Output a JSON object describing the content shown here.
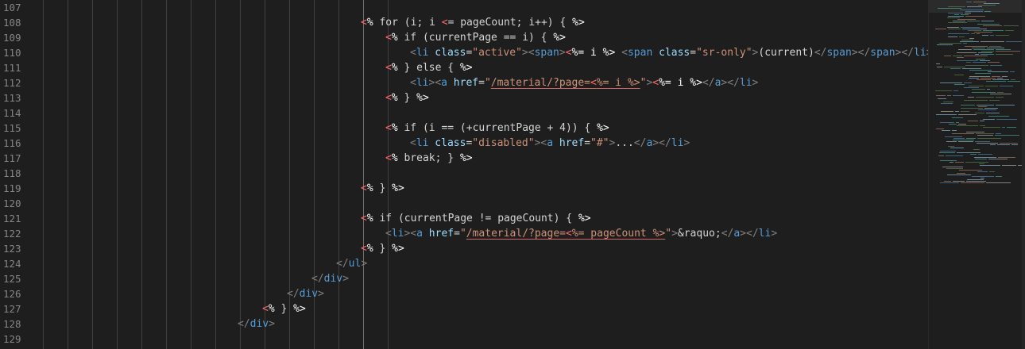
{
  "editor": {
    "lines": [
      {
        "num": "107",
        "indent": 0,
        "parts": []
      },
      {
        "num": "108",
        "indent": 454,
        "parts": [
          {
            "t": "<",
            "c": "tk-open"
          },
          {
            "t": "%",
            "c": "tk-delim"
          },
          {
            "t": " for (i; i ",
            "c": "tk-ejs"
          },
          {
            "t": "<",
            "c": "tk-open"
          },
          {
            "t": "= pageCount; i++) { ",
            "c": "tk-ejs"
          },
          {
            "t": "%>",
            "c": "tk-delim"
          }
        ]
      },
      {
        "num": "109",
        "indent": 485,
        "parts": [
          {
            "t": "<",
            "c": "tk-open"
          },
          {
            "t": "%",
            "c": "tk-delim"
          },
          {
            "t": " if (currentPage == i) { ",
            "c": "tk-ejs"
          },
          {
            "t": "%>",
            "c": "tk-delim"
          }
        ]
      },
      {
        "num": "110",
        "indent": 516,
        "parts": [
          {
            "t": "<",
            "c": "tk-punc"
          },
          {
            "t": "li",
            "c": "tk-tag"
          },
          {
            "t": " class",
            "c": "tk-attr"
          },
          {
            "t": "=",
            "c": "tk-ejs"
          },
          {
            "t": "\"active\"",
            "c": "tk-str"
          },
          {
            "t": ">",
            "c": "tk-punc"
          },
          {
            "t": "<",
            "c": "tk-punc"
          },
          {
            "t": "span",
            "c": "tk-tag"
          },
          {
            "t": ">",
            "c": "tk-punc"
          },
          {
            "t": "<",
            "c": "tk-open"
          },
          {
            "t": "%= i %>",
            "c": "tk-delim"
          },
          {
            "t": " ",
            "c": "tk-ejs"
          },
          {
            "t": "<",
            "c": "tk-punc"
          },
          {
            "t": "span",
            "c": "tk-tag"
          },
          {
            "t": " class",
            "c": "tk-attr"
          },
          {
            "t": "=",
            "c": "tk-ejs"
          },
          {
            "t": "\"sr-only\"",
            "c": "tk-str"
          },
          {
            "t": ">",
            "c": "tk-punc"
          },
          {
            "t": "(current)",
            "c": "tk-ejs"
          },
          {
            "t": "</",
            "c": "tk-punc"
          },
          {
            "t": "span",
            "c": "tk-tag"
          },
          {
            "t": ">",
            "c": "tk-punc"
          },
          {
            "t": "</",
            "c": "tk-punc"
          },
          {
            "t": "span",
            "c": "tk-tag"
          },
          {
            "t": ">",
            "c": "tk-punc"
          },
          {
            "t": "</",
            "c": "tk-punc"
          },
          {
            "t": "li",
            "c": "tk-tag"
          },
          {
            "t": ">",
            "c": "tk-punc"
          }
        ]
      },
      {
        "num": "111",
        "indent": 485,
        "parts": [
          {
            "t": "<",
            "c": "tk-open"
          },
          {
            "t": "%",
            "c": "tk-delim"
          },
          {
            "t": " } else { ",
            "c": "tk-ejs"
          },
          {
            "t": "%>",
            "c": "tk-delim"
          }
        ]
      },
      {
        "num": "112",
        "indent": 516,
        "parts": [
          {
            "t": "<",
            "c": "tk-punc"
          },
          {
            "t": "li",
            "c": "tk-tag"
          },
          {
            "t": ">",
            "c": "tk-punc"
          },
          {
            "t": "<",
            "c": "tk-punc"
          },
          {
            "t": "a",
            "c": "tk-tag"
          },
          {
            "t": " href",
            "c": "tk-attr"
          },
          {
            "t": "=",
            "c": "tk-ejs"
          },
          {
            "t": "\"",
            "c": "tk-str"
          },
          {
            "t": "/material/?page=",
            "c": "tk-str ul-str"
          },
          {
            "t": "<",
            "c": "tk-open ul-str"
          },
          {
            "t": "%= i %>",
            "c": "tk-str ul-str"
          },
          {
            "t": "\"",
            "c": "tk-str"
          },
          {
            "t": ">",
            "c": "tk-punc"
          },
          {
            "t": "<",
            "c": "tk-open"
          },
          {
            "t": "%= i %>",
            "c": "tk-delim"
          },
          {
            "t": "</",
            "c": "tk-punc"
          },
          {
            "t": "a",
            "c": "tk-tag"
          },
          {
            "t": ">",
            "c": "tk-punc"
          },
          {
            "t": "</",
            "c": "tk-punc"
          },
          {
            "t": "li",
            "c": "tk-tag"
          },
          {
            "t": ">",
            "c": "tk-punc"
          }
        ]
      },
      {
        "num": "113",
        "indent": 485,
        "parts": [
          {
            "t": "<",
            "c": "tk-open"
          },
          {
            "t": "%",
            "c": "tk-delim"
          },
          {
            "t": " } ",
            "c": "tk-ejs"
          },
          {
            "t": "%>",
            "c": "tk-delim"
          }
        ]
      },
      {
        "num": "114",
        "indent": 0,
        "parts": []
      },
      {
        "num": "115",
        "indent": 485,
        "parts": [
          {
            "t": "<",
            "c": "tk-open"
          },
          {
            "t": "%",
            "c": "tk-delim"
          },
          {
            "t": " if (i == (+currentPage + 4)) { ",
            "c": "tk-ejs"
          },
          {
            "t": "%>",
            "c": "tk-delim"
          }
        ]
      },
      {
        "num": "116",
        "indent": 516,
        "parts": [
          {
            "t": "<",
            "c": "tk-punc"
          },
          {
            "t": "li",
            "c": "tk-tag"
          },
          {
            "t": " class",
            "c": "tk-attr"
          },
          {
            "t": "=",
            "c": "tk-ejs"
          },
          {
            "t": "\"disabled\"",
            "c": "tk-str"
          },
          {
            "t": ">",
            "c": "tk-punc"
          },
          {
            "t": "<",
            "c": "tk-punc"
          },
          {
            "t": "a",
            "c": "tk-tag"
          },
          {
            "t": " href",
            "c": "tk-attr"
          },
          {
            "t": "=",
            "c": "tk-ejs"
          },
          {
            "t": "\"#\"",
            "c": "tk-str"
          },
          {
            "t": ">",
            "c": "tk-punc"
          },
          {
            "t": "...",
            "c": "tk-ejs"
          },
          {
            "t": "</",
            "c": "tk-punc"
          },
          {
            "t": "a",
            "c": "tk-tag"
          },
          {
            "t": ">",
            "c": "tk-punc"
          },
          {
            "t": "</",
            "c": "tk-punc"
          },
          {
            "t": "li",
            "c": "tk-tag"
          },
          {
            "t": ">",
            "c": "tk-punc"
          }
        ]
      },
      {
        "num": "117",
        "indent": 485,
        "parts": [
          {
            "t": "<",
            "c": "tk-open"
          },
          {
            "t": "%",
            "c": "tk-delim"
          },
          {
            "t": " break; } ",
            "c": "tk-ejs"
          },
          {
            "t": "%>",
            "c": "tk-delim"
          }
        ]
      },
      {
        "num": "118",
        "indent": 0,
        "parts": []
      },
      {
        "num": "119",
        "indent": 454,
        "parts": [
          {
            "t": "<",
            "c": "tk-open"
          },
          {
            "t": "%",
            "c": "tk-delim"
          },
          {
            "t": " } ",
            "c": "tk-ejs"
          },
          {
            "t": "%>",
            "c": "tk-delim"
          }
        ]
      },
      {
        "num": "120",
        "indent": 0,
        "parts": []
      },
      {
        "num": "121",
        "indent": 454,
        "parts": [
          {
            "t": "<",
            "c": "tk-open"
          },
          {
            "t": "%",
            "c": "tk-delim"
          },
          {
            "t": " if (currentPage != pageCount) { ",
            "c": "tk-ejs"
          },
          {
            "t": "%>",
            "c": "tk-delim"
          }
        ]
      },
      {
        "num": "122",
        "indent": 485,
        "parts": [
          {
            "t": "<",
            "c": "tk-punc"
          },
          {
            "t": "li",
            "c": "tk-tag"
          },
          {
            "t": ">",
            "c": "tk-punc"
          },
          {
            "t": "<",
            "c": "tk-punc"
          },
          {
            "t": "a",
            "c": "tk-tag"
          },
          {
            "t": " href",
            "c": "tk-attr"
          },
          {
            "t": "=",
            "c": "tk-ejs"
          },
          {
            "t": "\"",
            "c": "tk-str"
          },
          {
            "t": "/material/?page=",
            "c": "tk-str ul-str"
          },
          {
            "t": "<",
            "c": "tk-open ul-str"
          },
          {
            "t": "%= pageCount %>",
            "c": "tk-str ul-str"
          },
          {
            "t": "\"",
            "c": "tk-str"
          },
          {
            "t": ">",
            "c": "tk-punc"
          },
          {
            "t": "&raquo;",
            "c": "tk-ejs"
          },
          {
            "t": "</",
            "c": "tk-punc"
          },
          {
            "t": "a",
            "c": "tk-tag"
          },
          {
            "t": ">",
            "c": "tk-punc"
          },
          {
            "t": "</",
            "c": "tk-punc"
          },
          {
            "t": "li",
            "c": "tk-tag"
          },
          {
            "t": ">",
            "c": "tk-punc"
          }
        ]
      },
      {
        "num": "123",
        "indent": 454,
        "parts": [
          {
            "t": "<",
            "c": "tk-open"
          },
          {
            "t": "%",
            "c": "tk-delim"
          },
          {
            "t": " } ",
            "c": "tk-ejs"
          },
          {
            "t": "%>",
            "c": "tk-delim"
          }
        ]
      },
      {
        "num": "124",
        "indent": 423,
        "parts": [
          {
            "t": "</",
            "c": "tk-punc"
          },
          {
            "t": "ul",
            "c": "tk-tag"
          },
          {
            "t": ">",
            "c": "tk-punc"
          }
        ]
      },
      {
        "num": "125",
        "indent": 392,
        "parts": [
          {
            "t": "</",
            "c": "tk-punc"
          },
          {
            "t": "div",
            "c": "tk-tag"
          },
          {
            "t": ">",
            "c": "tk-punc"
          }
        ]
      },
      {
        "num": "126",
        "indent": 361,
        "parts": [
          {
            "t": "</",
            "c": "tk-punc"
          },
          {
            "t": "div",
            "c": "tk-tag"
          },
          {
            "t": ">",
            "c": "tk-punc"
          }
        ]
      },
      {
        "num": "127",
        "indent": 330,
        "parts": [
          {
            "t": "<",
            "c": "tk-open"
          },
          {
            "t": "%",
            "c": "tk-delim"
          },
          {
            "t": " } ",
            "c": "tk-ejs"
          },
          {
            "t": "%>",
            "c": "tk-delim"
          }
        ]
      },
      {
        "num": "128",
        "indent": 299,
        "parts": [
          {
            "t": "</",
            "c": "tk-punc"
          },
          {
            "t": "div",
            "c": "tk-tag"
          },
          {
            "t": ">",
            "c": "tk-punc"
          }
        ]
      },
      {
        "num": "129",
        "indent": 0,
        "parts": []
      }
    ]
  }
}
